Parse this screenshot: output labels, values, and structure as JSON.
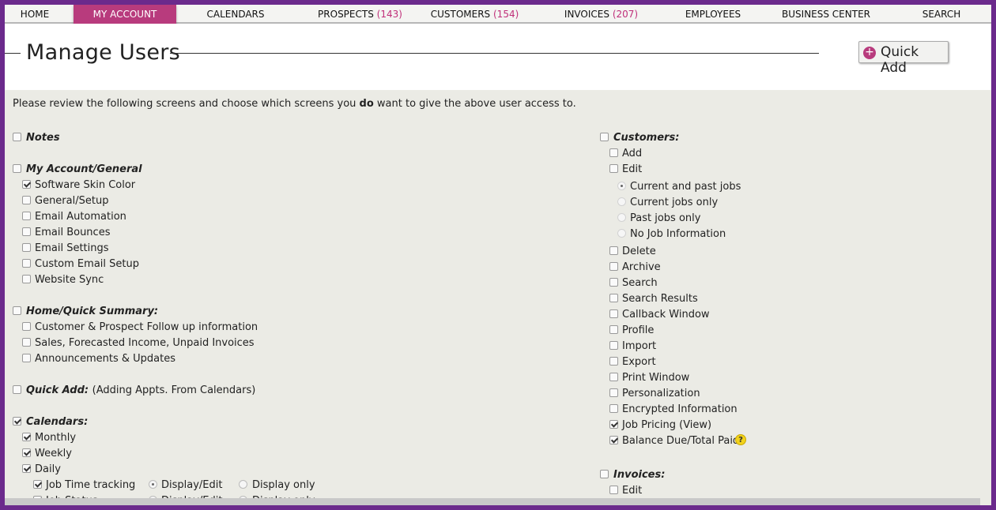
{
  "nav": {
    "home": "Home",
    "my_account": "My Account",
    "calendars": "Calendars",
    "prospects": "Prospects",
    "prospects_count": "(143)",
    "customers": "Customers",
    "customers_count": "(154)",
    "invoices": "Invoices",
    "invoices_count": "(207)",
    "employees": "Employees",
    "business_center": "Business Center",
    "search": "Search"
  },
  "page": {
    "title": "Manage Users",
    "quick_add": "Quick Add",
    "quick_add_icon": "+"
  },
  "intro": {
    "before": "Please review the following screens and choose which screens you ",
    "bold": "do",
    "after": " want to give the above user access to."
  },
  "left": {
    "notes": "Notes",
    "my_account": "My Account/General",
    "software_skin_color": "Software Skin Color",
    "general_setup": "General/Setup",
    "email_automation": "Email Automation",
    "email_bounces": "Email Bounces",
    "email_settings": "Email Settings",
    "custom_email_setup": "Custom Email Setup",
    "website_sync": "Website Sync",
    "home_quick_summary": "Home/Quick Summary:",
    "followup_info": "Customer & Prospect Follow up information",
    "sales_forecast": "Sales, Forecasted Income, Unpaid Invoices",
    "announcements": "Announcements & Updates",
    "quick_add": "Quick Add:",
    "quick_add_note": "(Adding Appts. From Calendars)",
    "calendars": "Calendars:",
    "monthly": "Monthly",
    "weekly": "Weekly",
    "daily": "Daily",
    "job_time_tracking": "Job Time tracking",
    "job_status": "Job Status",
    "display_edit": "Display/Edit",
    "display_only": "Display only"
  },
  "right": {
    "customers": "Customers:",
    "add": "Add",
    "edit": "Edit",
    "current_past_jobs": "Current and past jobs",
    "current_jobs_only": "Current jobs only",
    "past_jobs_only": "Past jobs only",
    "no_job_info": "No Job Information",
    "delete": "Delete",
    "archive": "Archive",
    "search": "Search",
    "search_results": "Search Results",
    "callback_window": "Callback Window",
    "profile": "Profile",
    "import": "Import",
    "export": "Export",
    "print_window": "Print Window",
    "personalization": "Personalization",
    "encrypted_information": "Encrypted Information",
    "job_pricing_view": "Job Pricing (View)",
    "balance_due": "Balance Due/Total Paid",
    "help_icon": "?",
    "invoices": "Invoices:",
    "invoices_edit": "Edit"
  },
  "colors": {
    "accent": "#b83b7d",
    "frame": "#6b2a8c",
    "panel": "#ebebe5",
    "help": "#f2d21b"
  },
  "icons": {
    "quick_add": "plus-circle-icon",
    "help": "question-mark-icon"
  }
}
